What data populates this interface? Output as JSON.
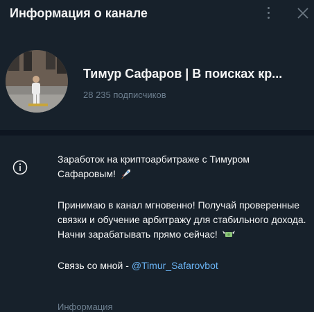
{
  "header": {
    "title": "Информация о канале",
    "more_icon": "kebab-vertical-icon",
    "close_icon": "close-icon"
  },
  "channel": {
    "name": "Тимур Сафаров | В поисках кр...",
    "subscribers": "28 235 подписчиков",
    "avatar_icon": "channel-avatar-photo"
  },
  "info": {
    "icon": "info-icon",
    "line1": "Заработок на криптоарбитраже с Тимуром Сафаровым!",
    "line1_emoji": "rocket-icon",
    "para2": "Принимаю в канал мгновенно! Получай проверенные связки и обучение арбитражу для стабильного дохода. Начни зарабатывать прямо сейчас!",
    "para2_emoji": "money-with-wings-icon",
    "contact_prefix": "Связь со мной - ",
    "contact_link": "@Timur_Safarovbot",
    "caption": "Информация"
  },
  "colors": {
    "background": "#17212b",
    "divider": "#0e1621",
    "text": "#f5f5f5",
    "muted": "#6d7f8f",
    "link": "#6ab3f3"
  }
}
